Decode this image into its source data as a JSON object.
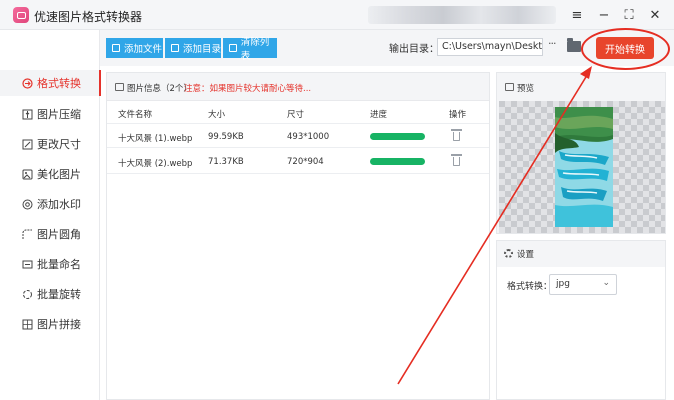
{
  "app": {
    "title": "优速图片格式转换器"
  },
  "window": {
    "menu_icon": "≡",
    "minimize_icon": "−",
    "maximize_icon": "⛶",
    "close_icon": "✕"
  },
  "sidebar": {
    "items": [
      {
        "label": "格式转换",
        "icon": "convert-icon",
        "active": true
      },
      {
        "label": "图片压缩",
        "icon": "compress-icon"
      },
      {
        "label": "更改尺寸",
        "icon": "resize-icon"
      },
      {
        "label": "美化图片",
        "icon": "beautify-icon"
      },
      {
        "label": "添加水印",
        "icon": "watermark-icon"
      },
      {
        "label": "图片圆角",
        "icon": "round-corner-icon"
      },
      {
        "label": "批量命名",
        "icon": "rename-icon"
      },
      {
        "label": "批量旋转",
        "icon": "rotate-icon"
      },
      {
        "label": "图片拼接",
        "icon": "stitch-icon"
      }
    ]
  },
  "toolbar": {
    "add_file": "添加文件",
    "add_folder": "添加目录",
    "clear_list": "清除列表",
    "output_label": "输出目录：",
    "output_path": "C:\\Users\\mayn\\Desktop",
    "more": "···",
    "start": "开始转换"
  },
  "file_panel": {
    "title": "图片信息（2个）",
    "notice": "注意：如果图片较大请耐心等待...",
    "columns": [
      "文件名称",
      "大小",
      "尺寸",
      "进度",
      "操作"
    ],
    "rows": [
      {
        "name": "十大风景 (1).webp",
        "size": "99.59KB",
        "dims": "493*1000",
        "progress": 1.0
      },
      {
        "name": "十大风景 (2).webp",
        "size": "71.37KB",
        "dims": "720*904",
        "progress": 1.0
      }
    ]
  },
  "preview": {
    "title": "预览"
  },
  "settings": {
    "title": "设置",
    "format_label": "格式转换：",
    "format_value": "jpg"
  },
  "colors": {
    "accent": "#e5322b",
    "toolbar_button": "#30a6e8",
    "start_button": "#e8452c",
    "progress": "#17b364"
  }
}
